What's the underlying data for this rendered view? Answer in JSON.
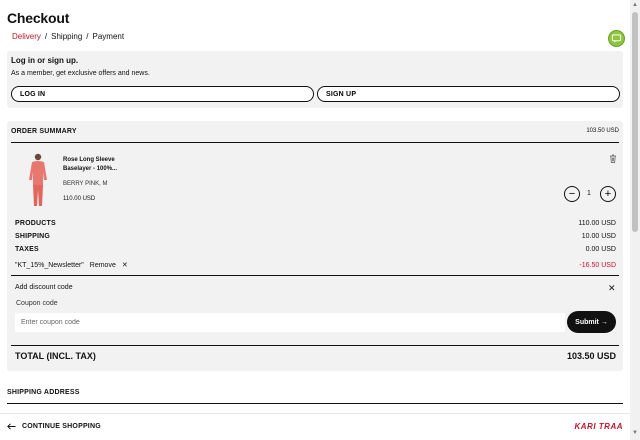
{
  "header": {
    "title": "Checkout"
  },
  "breadcrumb": {
    "items": [
      "Delivery",
      "Shipping",
      "Payment"
    ],
    "separator": "/",
    "active_color": "#c8102e"
  },
  "help_badge": {
    "icon": "chat-icon",
    "color": "#8ec63f"
  },
  "login": {
    "title": "Log in or sign up.",
    "subtitle": "As a member, get exclusive offers and news.",
    "login_label": "LOG IN",
    "signup_label": "SIGN UP"
  },
  "summary": {
    "title": "ORDER SUMMARY",
    "total_top": "103.50 USD",
    "product": {
      "name": "Rose Long Sleeve Baselayer - 100%...",
      "variant": "BERRY PINK, M",
      "price": "110.00 USD",
      "quantity": "1",
      "image_color": "#e8776f"
    },
    "lines": [
      {
        "label": "PRODUCTS",
        "value": "110.00 USD"
      },
      {
        "label": "SHIPPING",
        "value": "10.00 USD"
      },
      {
        "label": "TAXES",
        "value": "0.00 USD"
      }
    ],
    "coupon": {
      "code": "\"KT_15%_Newsletter\"",
      "remove_label": "Remove",
      "value": "-16.50 USD"
    },
    "discount": {
      "title": "Add discount code",
      "field_label": "Coupon code",
      "placeholder": "Enter coupon code",
      "submit_label": "Submit →"
    },
    "total": {
      "label": "TOTAL (INCL. TAX)",
      "value": "103.50 USD"
    }
  },
  "shipping": {
    "title": "SHIPPING ADDRESS"
  },
  "footer": {
    "continue_label": "CONTINUE SHOPPING",
    "brand": "KARI TRAA",
    "brand_color": "#c8102e"
  }
}
